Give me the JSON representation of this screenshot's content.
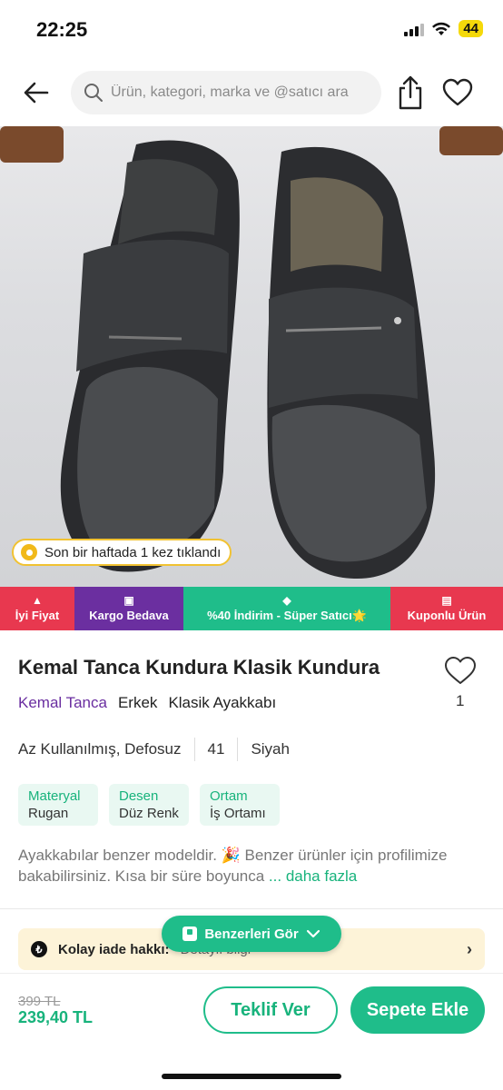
{
  "status_bar": {
    "time": "22:25",
    "battery": "44"
  },
  "search": {
    "placeholder": "Ürün, kategori, marka ve @satıcı ara"
  },
  "image": {
    "click_info": "Son bir haftada 1 kez tıklandı"
  },
  "badges": [
    {
      "label": "İyi Fiyat",
      "icon": "flame-icon",
      "color": "#e8384f"
    },
    {
      "label": "Kargo Bedava",
      "icon": "box-icon",
      "color": "#6b2fa0"
    },
    {
      "label": "%40 İndirim - Süper Satıcı🌟",
      "icon": "tag-icon",
      "color": "#1fbd8a"
    },
    {
      "label": "Kuponlu Ürün",
      "icon": "ticket-icon",
      "color": "#e8384f"
    }
  ],
  "product": {
    "title": "Kemal Tanca Kundura Klasik Kundura",
    "brand": "Kemal Tanca",
    "gender": "Erkek",
    "category": "Klasik Ayakkabı",
    "favorite_count": "1",
    "condition": "Az Kullanılmış, Defosuz",
    "size": "41",
    "color": "Siyah"
  },
  "chips": [
    {
      "key": "Materyal",
      "value": "Rugan"
    },
    {
      "key": "Desen",
      "value": "Düz Renk"
    },
    {
      "key": "Ortam",
      "value": "İş Ortamı"
    }
  ],
  "description": {
    "text": "Ayakkabılar benzer modeldir. 🎉 Benzer ürünler için profilimize bakabilirsiniz. Kısa bir süre boyunca",
    "more": "... daha fazla"
  },
  "similar_button": "Benzerleri Gör",
  "return_info": {
    "label": "Kolay iade hakkı:",
    "detail": "Detaylı bilgi"
  },
  "pricing": {
    "old_price": "399 TL",
    "price": "239,40 TL"
  },
  "actions": {
    "offer": "Teklif Ver",
    "add_to_cart": "Sepete Ekle"
  },
  "colors": {
    "accent": "#1fbd8a",
    "brand_purple": "#6b2fa0",
    "badge_red": "#e8384f"
  }
}
